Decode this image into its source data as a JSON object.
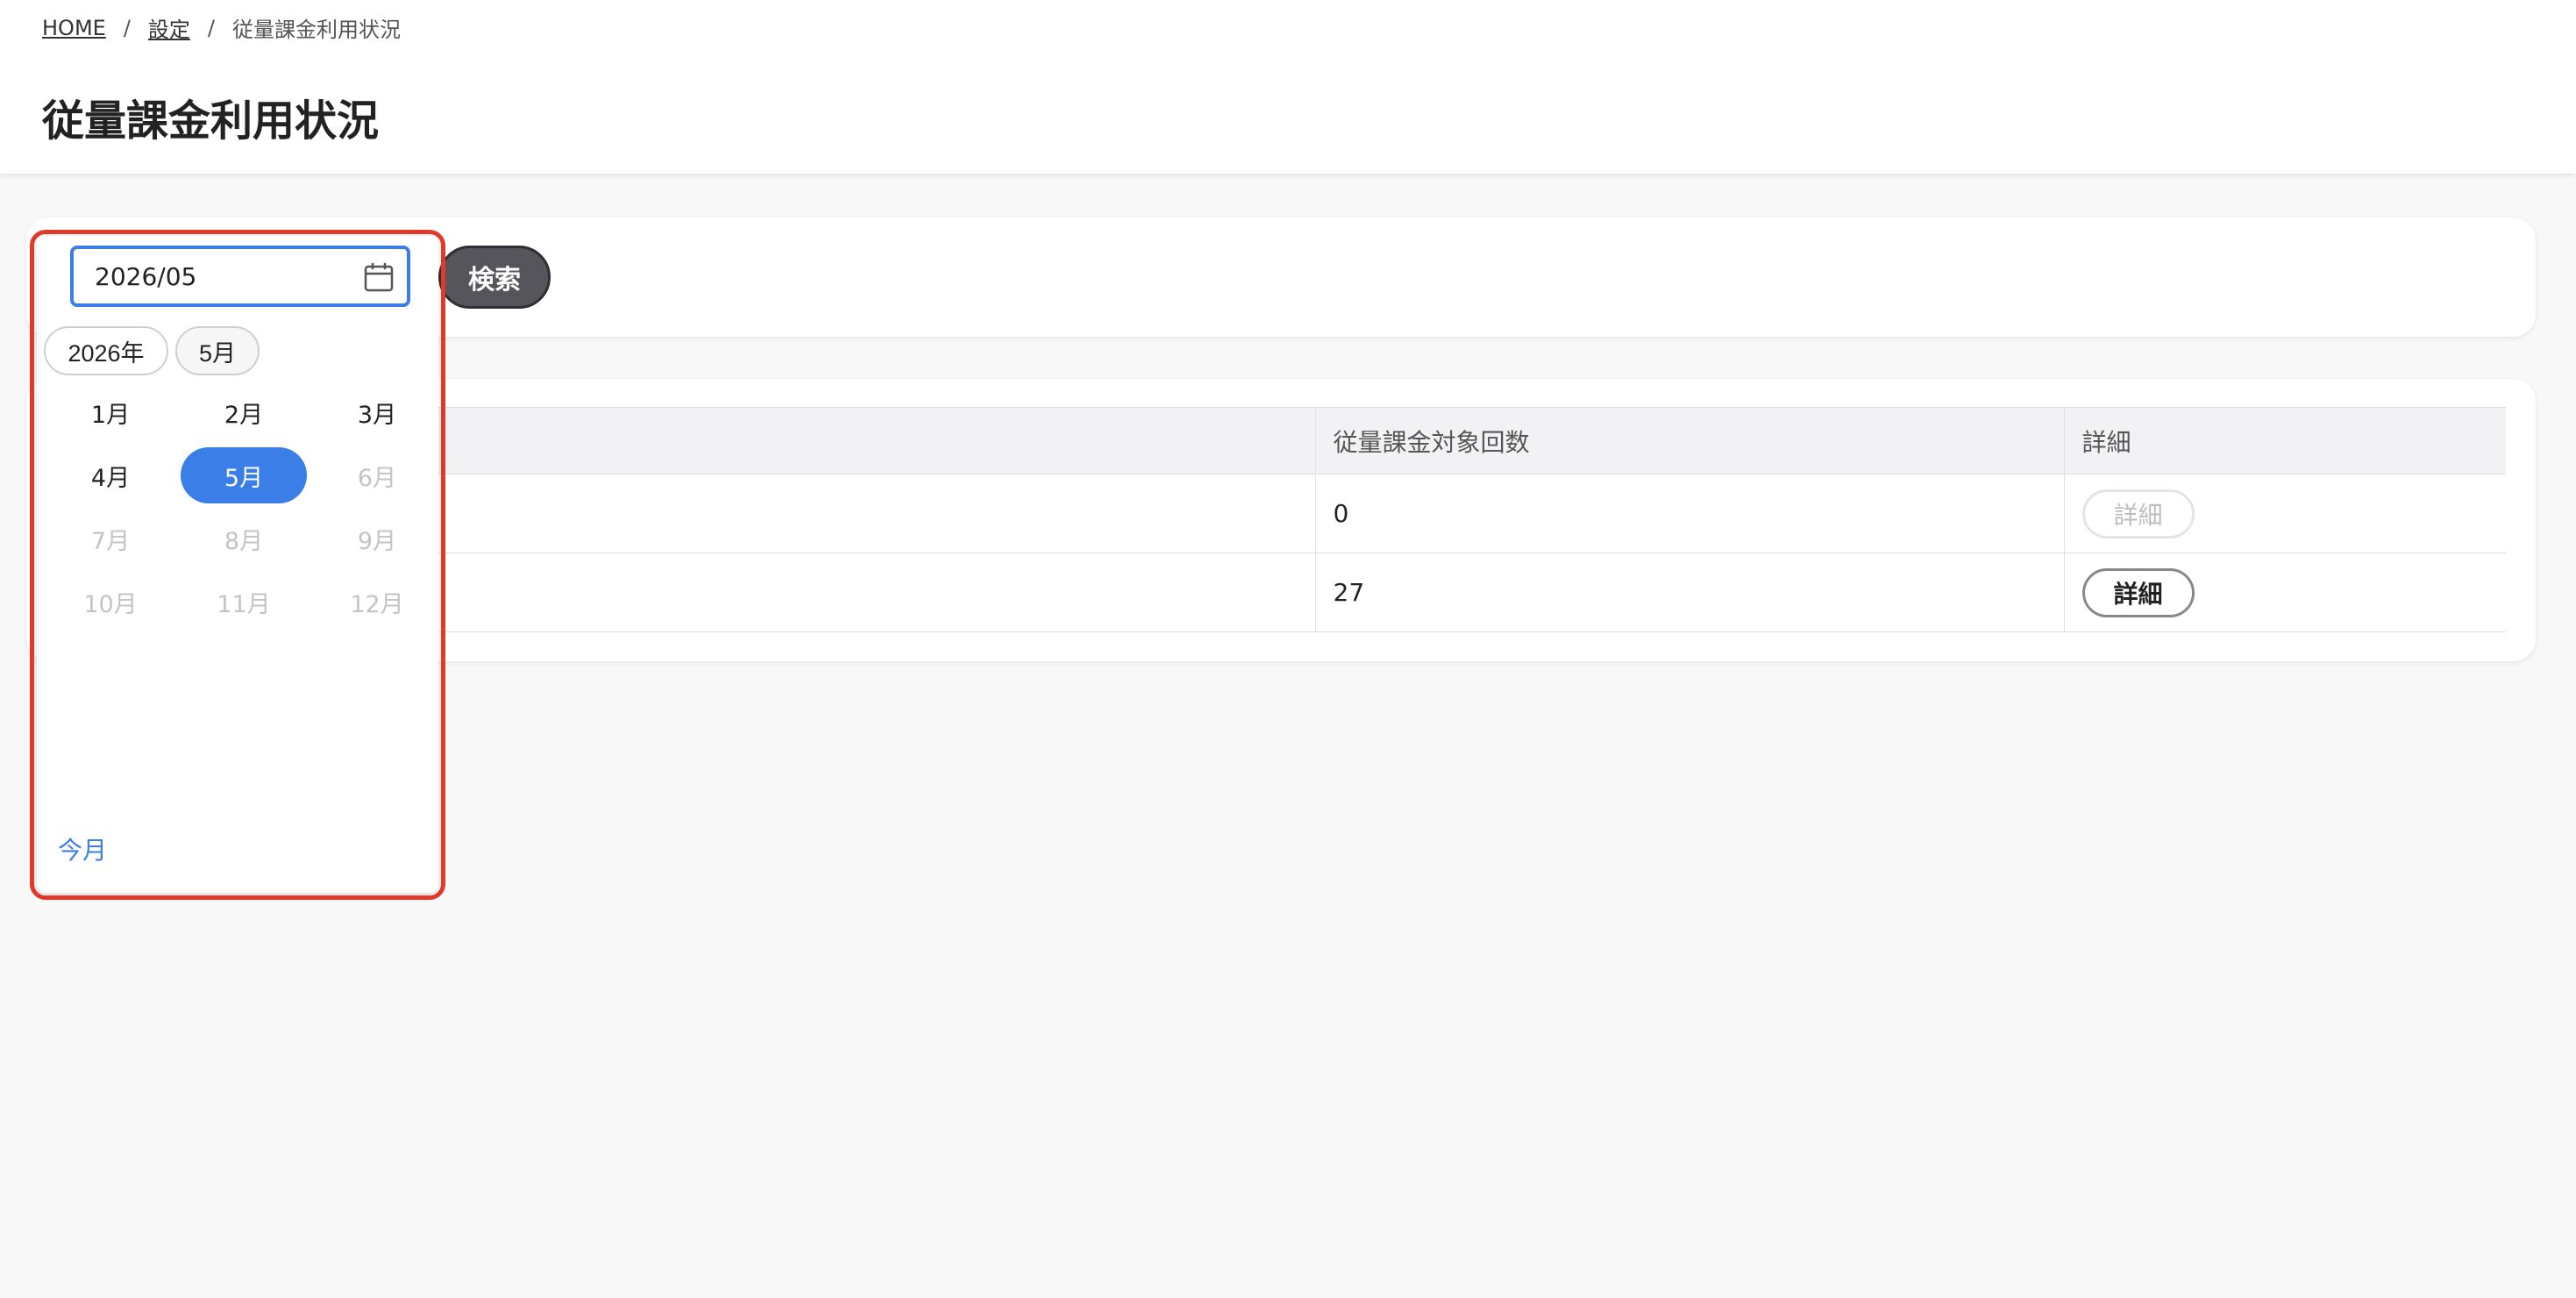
{
  "breadcrumb": {
    "home": "HOME",
    "settings": "設定",
    "separator": "/",
    "current": "従量課金利用状況"
  },
  "page_title": "従量課金利用状況",
  "search": {
    "month_value": "2026/05",
    "button_label": "検索"
  },
  "month_picker": {
    "year_chip": "2026年",
    "month_chip": "5月",
    "months": [
      {
        "label": "1月",
        "state": "enabled"
      },
      {
        "label": "2月",
        "state": "enabled"
      },
      {
        "label": "3月",
        "state": "enabled"
      },
      {
        "label": "4月",
        "state": "enabled"
      },
      {
        "label": "5月",
        "state": "selected"
      },
      {
        "label": "6月",
        "state": "disabled"
      },
      {
        "label": "7月",
        "state": "disabled"
      },
      {
        "label": "8月",
        "state": "disabled"
      },
      {
        "label": "9月",
        "state": "disabled"
      },
      {
        "label": "10月",
        "state": "disabled"
      },
      {
        "label": "11月",
        "state": "disabled"
      },
      {
        "label": "12月",
        "state": "disabled"
      }
    ],
    "this_month_link": "今月",
    "icon": "calendar-icon"
  },
  "table": {
    "headers": [
      "",
      "従量課金対象回数",
      "詳細"
    ],
    "rows": [
      {
        "count": "0",
        "detail_label": "詳細",
        "detail_enabled": false
      },
      {
        "count": "27",
        "detail_label": "詳細",
        "detail_enabled": true
      }
    ]
  },
  "colors": {
    "accent": "#3b7ee8",
    "highlight_border": "#e23a2a",
    "search_button": "#55555b"
  }
}
